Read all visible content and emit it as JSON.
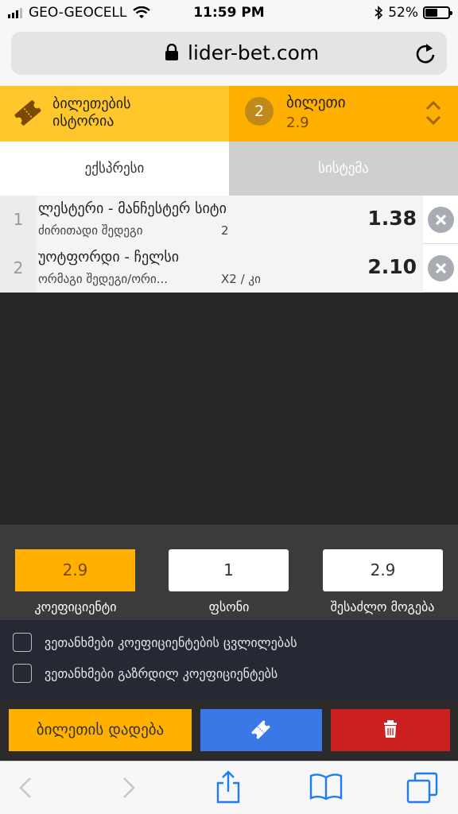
{
  "status_bar": {
    "carrier": "GEO-GEOCELL",
    "time": "11:59 PM",
    "battery": "52%",
    "battery_level": 0.52
  },
  "browser": {
    "host": "lider-bet.com"
  },
  "ticket_header": {
    "history_label_line1": "ბილეთების",
    "history_label_line2": "ისტორია",
    "ticket_count": "2",
    "ticket_label": "ბილეთი",
    "ticket_odds": "2.9"
  },
  "tabs": {
    "express": "ექსპრესი",
    "system": "სისტემა"
  },
  "bets": [
    {
      "index": "1",
      "match": "ლესტერი - მანჩესტერ სიტი",
      "market": "ძირითადი შედეგი",
      "outcome": "2",
      "odd": "1.38"
    },
    {
      "index": "2",
      "match": "უოტფორდი - ჩელსი",
      "market": "ორმაგი შედეგი/ორი...",
      "outcome": "X2 / კი",
      "odd": "2.10"
    }
  ],
  "summary": {
    "coef_value": "2.9",
    "coef_label": "კოეფიციენტი",
    "stake_value": "1",
    "stake_label": "ფსონი",
    "win_value": "2.9",
    "win_label": "შესაძლო მოგება"
  },
  "agreements": {
    "accept_changes": "ვეთანხმები კოეფიციენტების ცვლილებას",
    "accept_increase": "ვეთანხმები გაზრდილ კოეფიციენტებს"
  },
  "actions": {
    "place_bet": "ბილეთის დადება"
  },
  "colors": {
    "accent_yellow": "#ffb000",
    "history_yellow": "#ffc72c",
    "share_blue": "#3b78e7",
    "delete_red": "#cc2020"
  }
}
